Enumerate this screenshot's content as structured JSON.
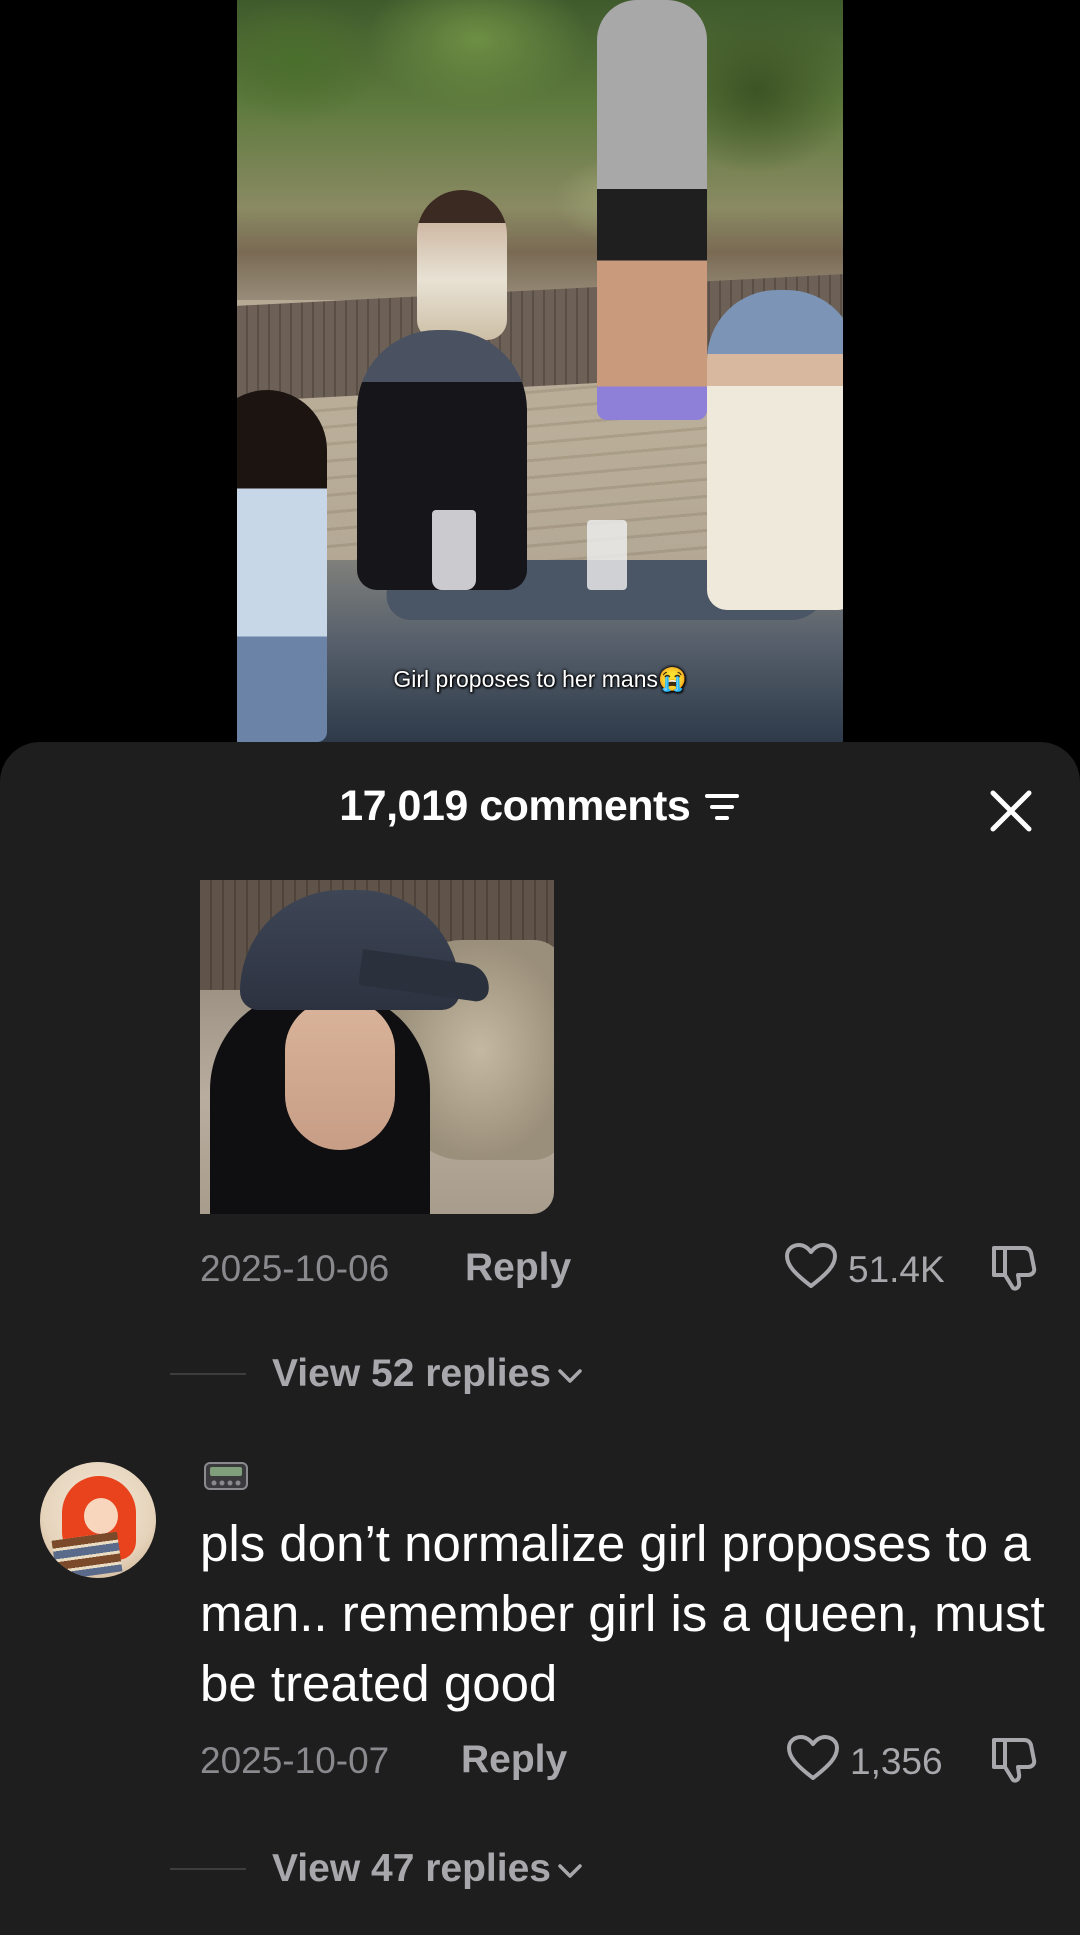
{
  "video": {
    "caption": "Girl proposes to her mans😭"
  },
  "comments_panel": {
    "count_label": "17,019 comments",
    "sort_icon": "filter-lines-icon",
    "close_icon": "close-icon"
  },
  "comments": [
    {
      "type": "image",
      "date": "2025-10-06",
      "reply_label": "Reply",
      "like_count": "51.4K",
      "view_replies_label": "View 52 replies"
    },
    {
      "type": "text",
      "badge_icon": "pager-icon",
      "text": "pls don’t normalize girl proposes to a man.. remember girl is a queen, must be treated good",
      "date": "2025-10-07",
      "reply_label": "Reply",
      "like_count": "1,356",
      "view_replies_label": "View 47 replies"
    }
  ],
  "colors": {
    "sheet_bg": "#1e1e1f",
    "muted_text": "#8a8a8e",
    "secondary_text": "#a8a8ac",
    "primary_text": "#ffffff"
  }
}
